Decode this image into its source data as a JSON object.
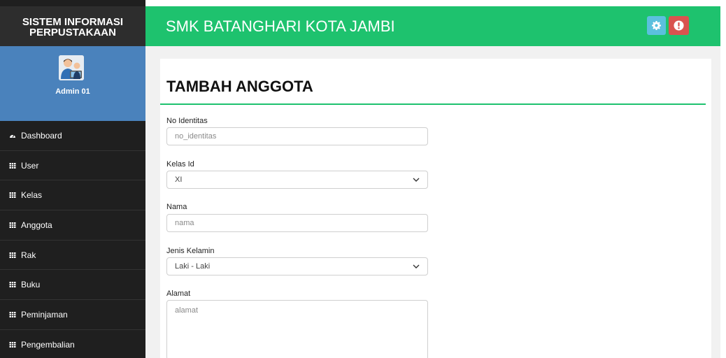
{
  "sidebar": {
    "brand_line1": "SISTEM INFORMASI",
    "brand_line2": "PERPUSTAKAAN",
    "user_name": "Admin 01",
    "menu": [
      {
        "label": "Dashboard",
        "icon": "dashboard-icon"
      },
      {
        "label": "User",
        "icon": "table-icon"
      },
      {
        "label": "Kelas",
        "icon": "table-icon"
      },
      {
        "label": "Anggota",
        "icon": "table-icon"
      },
      {
        "label": "Rak",
        "icon": "table-icon"
      },
      {
        "label": "Buku",
        "icon": "table-icon"
      },
      {
        "label": "Peminjaman",
        "icon": "table-icon"
      },
      {
        "label": "Pengembalian",
        "icon": "table-icon"
      }
    ]
  },
  "header": {
    "title": "SMK BATANGHARI KOTA JAMBI",
    "settings_icon": "gear-icon",
    "logout_icon": "exclamation-icon"
  },
  "form": {
    "title": "TAMBAH ANGGOTA",
    "no_identitas_label": "No Identitas",
    "no_identitas_placeholder": "no_identitas",
    "kelas_label": "Kelas Id",
    "kelas_value": "XI",
    "nama_label": "Nama",
    "nama_placeholder": "nama",
    "jk_label": "Jenis Kelamin",
    "jk_value": "Laki - Laki",
    "alamat_label": "Alamat",
    "alamat_placeholder": "alamat"
  },
  "colors": {
    "header_green": "#1ec26e",
    "sidebar_dark": "#1f1f1f",
    "user_panel_blue": "#4a82bc",
    "settings_button": "#5bc0de",
    "logout_button": "#d9534f"
  }
}
